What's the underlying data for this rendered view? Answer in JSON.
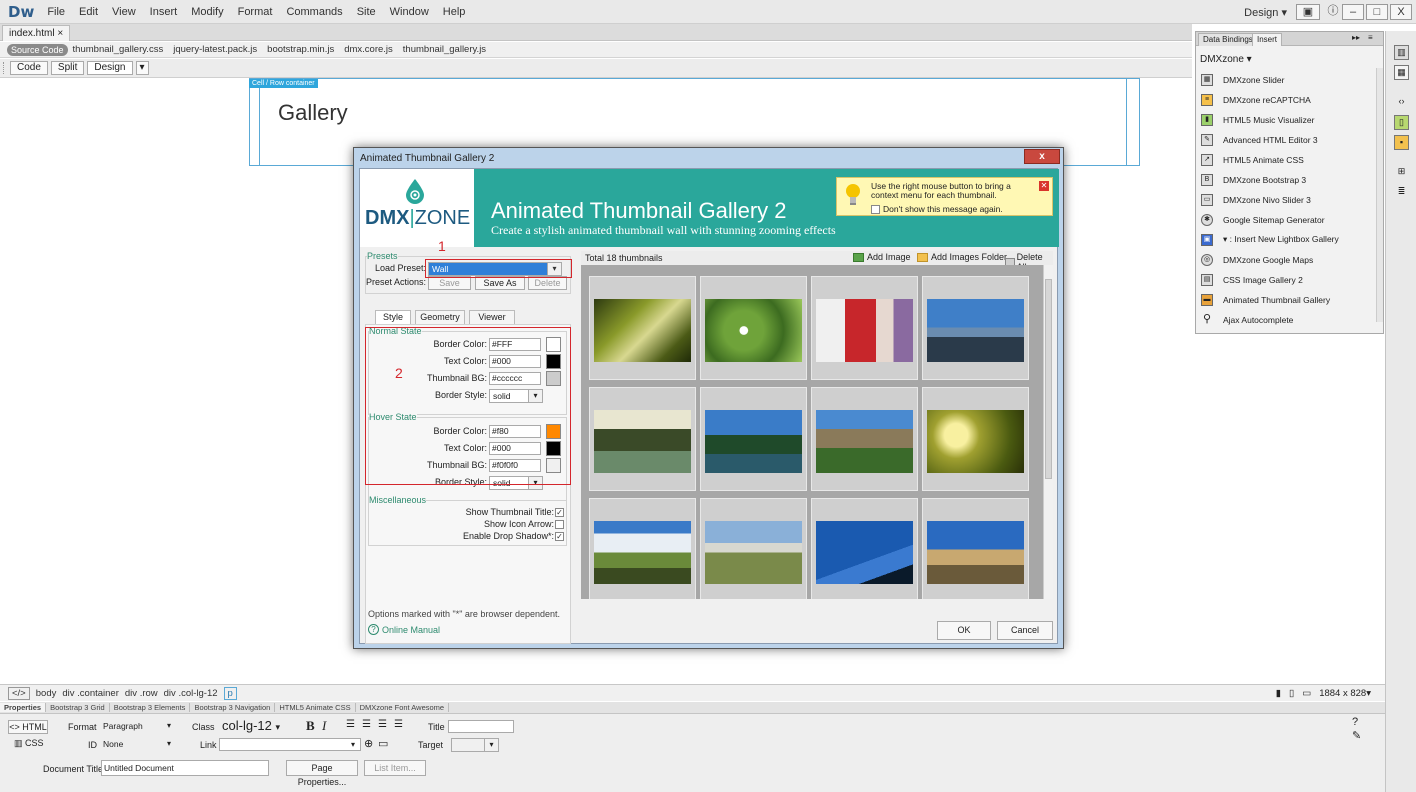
{
  "app": {
    "logo": "Dw",
    "menu": [
      "File",
      "Edit",
      "View",
      "Insert",
      "Modify",
      "Format",
      "Commands",
      "Site",
      "Window",
      "Help"
    ],
    "workspace": "Design",
    "window_buttons": [
      "–",
      "□",
      "X"
    ]
  },
  "document": {
    "tab": "index.html",
    "source_code": "Source Code",
    "related_files": [
      "thumbnail_gallery.css",
      "jquery-latest.pack.js",
      "bootstrap.min.js",
      "dmx.core.js",
      "thumbnail_gallery.js"
    ],
    "view_buttons": [
      "Code",
      "Split",
      "Design"
    ],
    "cell_tag": "Cell / Row container",
    "heading": "Gallery"
  },
  "dialog": {
    "title": "Animated Thumbnail Gallery 2",
    "close": "x",
    "logo_dmx": "DMX",
    "logo_zone": "ZONE",
    "banner_title": "Animated Thumbnail Gallery 2",
    "banner_subtitle": "Create a stylish animated thumbnail wall with stunning zooming effects",
    "tip": {
      "text": "Use the right mouse button to bring a context menu for each thumbnail.",
      "checkbox": "Don't show this message again."
    },
    "annotations": [
      "1",
      "2"
    ],
    "presets": {
      "group": "Presets",
      "load_label": "Load Preset:",
      "load_value": "Wall",
      "actions_label": "Preset Actions:",
      "save": "Save",
      "save_as": "Save As",
      "delete": "Delete"
    },
    "tabs": [
      "Style",
      "Geometry",
      "Viewer"
    ],
    "normal_state": {
      "group": "Normal State",
      "border_color_label": "Border Color:",
      "border_color": "#FFF",
      "text_color_label": "Text Color:",
      "text_color": "#000",
      "thumb_bg_label": "Thumbnail BG:",
      "thumb_bg": "#cccccc",
      "border_style_label": "Border Style:",
      "border_style": "solid"
    },
    "hover_state": {
      "group": "Hover State",
      "border_color_label": "Border Color:",
      "border_color": "#f80",
      "text_color_label": "Text Color:",
      "text_color": "#000",
      "thumb_bg_label": "Thumbnail BG:",
      "thumb_bg": "#f0f0f0",
      "border_style_label": "Border Style:",
      "border_style": "solid"
    },
    "misc": {
      "group": "Miscellaneous",
      "show_title": "Show Thumbnail Title:",
      "show_arrow": "Show Icon Arrow:",
      "drop_shadow": "Enable Drop Shadow*:"
    },
    "footnote": "Options marked with \"*\" are browser dependent.",
    "manual": "Online Manual",
    "total": "Total 18 thumbnails",
    "add_image": "Add Image",
    "add_folder": "Add Images Folder",
    "delete_all": "Delete All",
    "ok": "OK",
    "cancel": "Cancel"
  },
  "insert_panel": {
    "tabs": [
      "Data Bindings",
      "Insert"
    ],
    "category": "DMXzone",
    "items": [
      "DMXzone Slider",
      "DMXzone reCAPTCHA",
      "HTML5 Music Visualizer",
      "Advanced HTML Editor 3",
      "HTML5 Animate CSS",
      "DMXzone Bootstrap 3",
      "DMXzone Nivo Slider 3",
      "Google Sitemap Generator",
      "▾ : Insert New Lightbox Gallery",
      "DMXzone Google Maps",
      "CSS Image Gallery 2",
      "Animated Thumbnail Gallery",
      "Ajax Autocomplete"
    ]
  },
  "tag_selector": {
    "items": [
      "body",
      "div",
      "div",
      "div",
      "p"
    ],
    "classes": [
      ".container",
      ".row",
      ".col-lg-12"
    ],
    "size": "1884 x 828"
  },
  "properties": {
    "tabs": [
      "Properties",
      "Bootstrap 3 Grid",
      "Bootstrap 3 Elements",
      "Bootstrap 3 Navigation",
      "HTML5 Animate CSS",
      "DMXzone Font Awesome"
    ],
    "html_btn": "HTML",
    "css_btn": "CSS",
    "format_label": "Format",
    "format_value": "Paragraph",
    "class_label": "Class",
    "class_value": "col-lg-12",
    "id_label": "ID",
    "id_value": "None",
    "link_label": "Link",
    "title_label": "Title",
    "target_label": "Target",
    "doc_title_label": "Document Title",
    "doc_title_value": "Untitled Document",
    "page_props": "Page Properties...",
    "list_item": "List Item..."
  }
}
